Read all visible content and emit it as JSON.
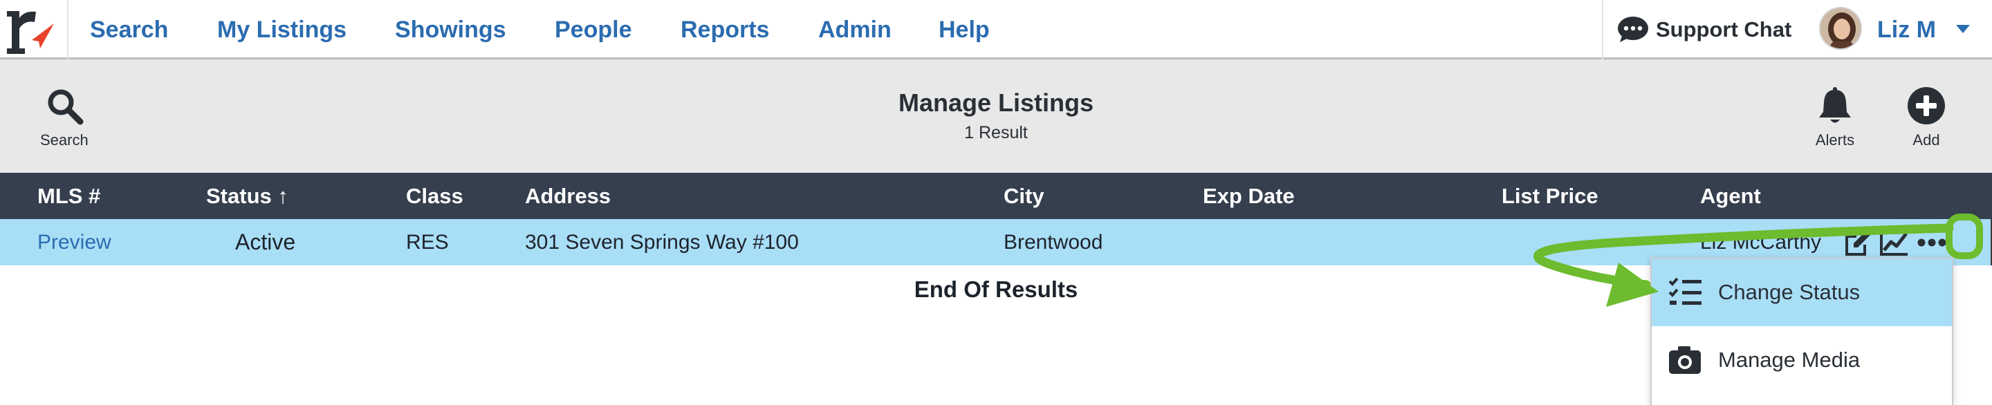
{
  "nav": {
    "items": [
      {
        "label": "Search"
      },
      {
        "label": "My Listings"
      },
      {
        "label": "Showings"
      },
      {
        "label": "People"
      },
      {
        "label": "Reports"
      },
      {
        "label": "Admin"
      },
      {
        "label": "Help"
      }
    ],
    "support_label": "Support Chat",
    "user_name": "Liz M"
  },
  "toolbar": {
    "search_label": "Search",
    "title": "Manage Listings",
    "result_count": "1 Result",
    "alerts_label": "Alerts",
    "add_label": "Add"
  },
  "table": {
    "columns": [
      "MLS #",
      "Status ↑",
      "Class",
      "Address",
      "City",
      "Exp Date",
      "List Price",
      "Agent"
    ],
    "rows": [
      {
        "mls": "Preview",
        "status": "Active",
        "class": "RES",
        "address": "301 Seven Springs Way #100",
        "city": "Brentwood",
        "exp_date": "",
        "list_price": "",
        "agent": "Liz McCarthy"
      }
    ],
    "end_text": "End Of Results"
  },
  "menu": {
    "items": [
      {
        "label": "Change Status",
        "icon": "checklist-icon"
      },
      {
        "label": "Manage Media",
        "icon": "camera-icon"
      }
    ]
  },
  "colors": {
    "brand_blue": "#2b6cb0",
    "header_dark": "#353f4e",
    "row_highlight": "#a9def7",
    "toolbar_bg": "#e8e8e8",
    "annotation_green": "#6dbb2e",
    "logo_red": "#e8432a"
  }
}
